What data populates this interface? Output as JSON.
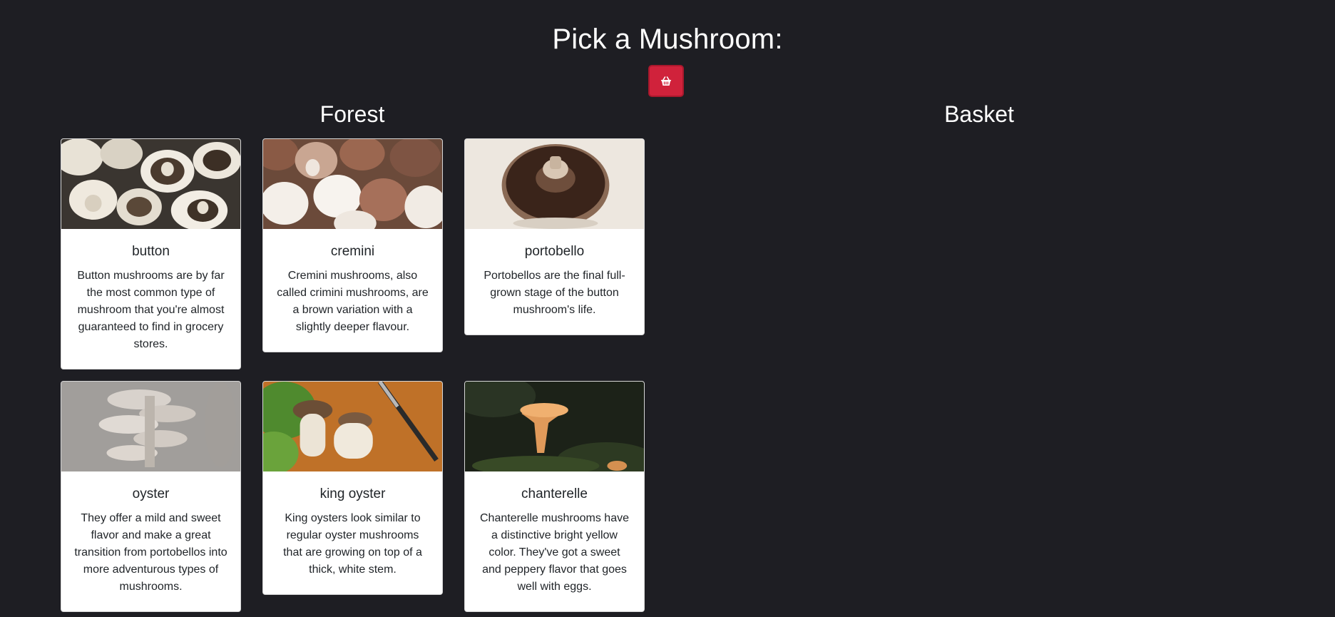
{
  "header": {
    "title": "Pick a Mushroom:",
    "basket_button_icon": "basket-icon",
    "accent_color": "#d0223b"
  },
  "forest": {
    "heading": "Forest"
  },
  "basket": {
    "heading": "Basket",
    "items": []
  },
  "mushrooms": [
    {
      "name": "button",
      "description": "Button mushrooms are by far the most common type of mushroom that you're almost guaranteed to find in grocery stores."
    },
    {
      "name": "cremini",
      "description": "Cremini mushrooms, also called crimini mushrooms, are a brown variation with a slightly deeper flavour."
    },
    {
      "name": "portobello",
      "description": "Portobellos are the final full-grown stage of the button mushroom's life."
    },
    {
      "name": "oyster",
      "description": "They offer a mild and sweet flavor and make a great transition from portobellos into more adventurous types of mushrooms."
    },
    {
      "name": "king oyster",
      "description": "King oysters look similar to regular oyster mushrooms that are growing on top of a thick, white stem."
    },
    {
      "name": "chanterelle",
      "description": "Chanterelle mushrooms have a distinctive bright yellow color. They've got a sweet and peppery flavor that goes well with eggs."
    }
  ]
}
